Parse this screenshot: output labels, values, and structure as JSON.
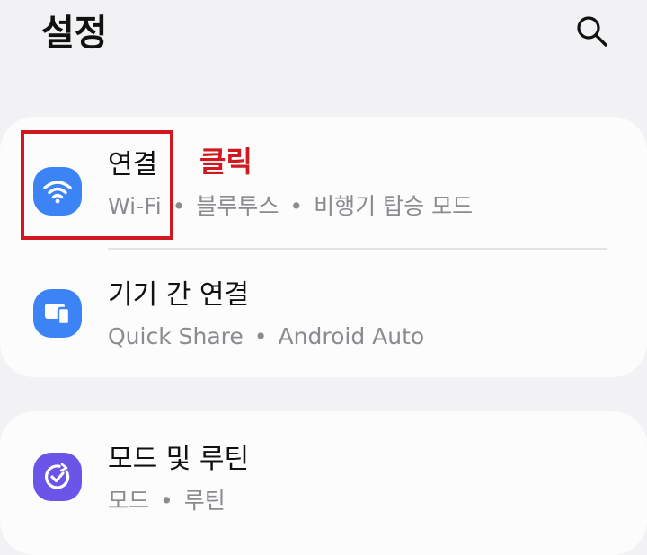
{
  "header": {
    "title": "설정"
  },
  "icons": {
    "search": "search-icon",
    "connections": "wifi-icon",
    "device_connections": "devices-icon",
    "modes_routines": "check-circle-icon"
  },
  "settings": {
    "connections": {
      "title": "연결",
      "sub": [
        "Wi-Fi",
        "블루투스",
        "비행기 탑승 모드"
      ]
    },
    "device_connections": {
      "title": "기기 간 연결",
      "sub": [
        "Quick Share",
        "Android Auto"
      ]
    },
    "modes_routines": {
      "title": "모드 및 루틴",
      "sub": [
        "모드",
        "루틴"
      ]
    }
  },
  "annotation": {
    "label": "클릭",
    "color": "#d0181e"
  },
  "colors": {
    "background": "#f2f2f4",
    "card": "#fcfcfd",
    "blue_icon": "#3c84f5",
    "purple_icon": "#6a55e8",
    "subtext": "#8a8a8f"
  }
}
